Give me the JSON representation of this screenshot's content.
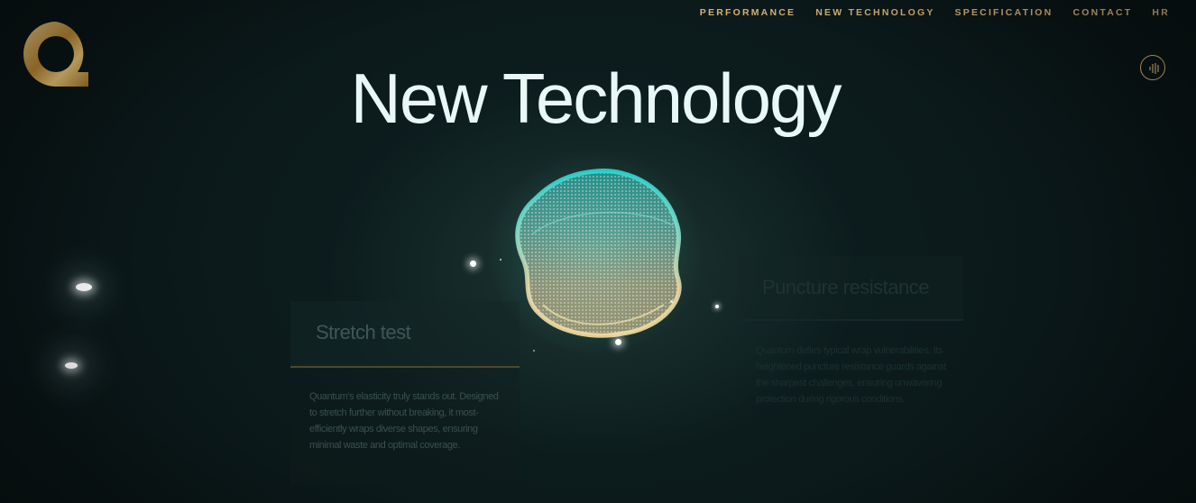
{
  "brand": {
    "logo_icon": "q-logo-icon"
  },
  "nav": {
    "items": [
      {
        "label": "PERFORMANCE"
      },
      {
        "label": "NEW TECHNOLOGY"
      },
      {
        "label": "SPECIFICATION"
      },
      {
        "label": "CONTACT"
      },
      {
        "label": "HR"
      }
    ]
  },
  "audio_toggle": {
    "icon": "sound-wave-icon"
  },
  "hero": {
    "title": "New Technology"
  },
  "cards": {
    "stretch": {
      "title": "Stretch test",
      "body": "Quantum's elasticity truly stands out. Designed to stretch further without breaking, it most-efficiently wraps diverse shapes, ensuring minimal waste and optimal coverage."
    },
    "puncture": {
      "title": "Puncture resistance",
      "body": "Quantum defies typical wrap vulnerabilities. Its heightened puncture resistance guards against the sharpest challenges, ensuring unwavering protection during rigorous conditions."
    }
  },
  "colors": {
    "accent_gold": "#d6b273",
    "title_white": "#e9f7f7",
    "background": "#0a1617",
    "orb_teal": "#3fd6cf",
    "orb_cream": "#f3dfae"
  }
}
